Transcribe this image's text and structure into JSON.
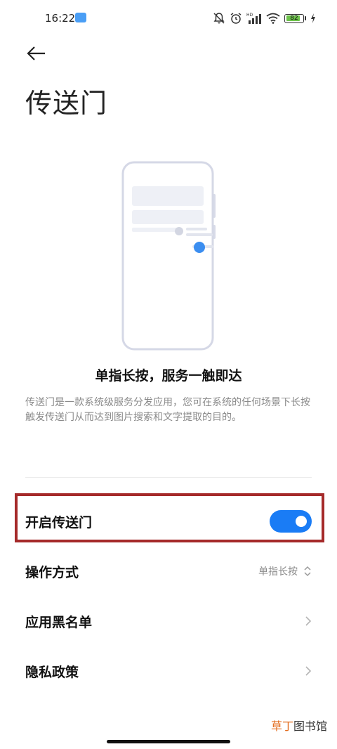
{
  "status_bar": {
    "time": "16:22",
    "battery_level": "82",
    "icons": [
      "app-notification-icon",
      "mute-icon",
      "alarm-icon",
      "hd-signal-icon",
      "wifi-icon",
      "battery-icon",
      "charging-icon"
    ]
  },
  "header": {
    "back_icon": "arrow-left-icon",
    "title": "传送门"
  },
  "intro": {
    "headline": "单指长按，服务一触即达",
    "description": "传送门是一款系统级服务分发应用，您可在系统的任何场景下长按触发传送门从而达到图片搜索和文字提取的目的。"
  },
  "settings": {
    "enable": {
      "label": "开启传送门",
      "toggle_on": true
    },
    "mode": {
      "label": "操作方式",
      "value": "单指长按"
    },
    "blacklist": {
      "label": "应用黑名单"
    },
    "privacy": {
      "label": "隐私政策"
    }
  },
  "watermark": {
    "accent": "草丁",
    "text": "图书馆"
  },
  "colors": {
    "accent": "#1a7cf5",
    "highlight_border": "#a52a2a",
    "secondary_text": "#8a8a8a"
  }
}
